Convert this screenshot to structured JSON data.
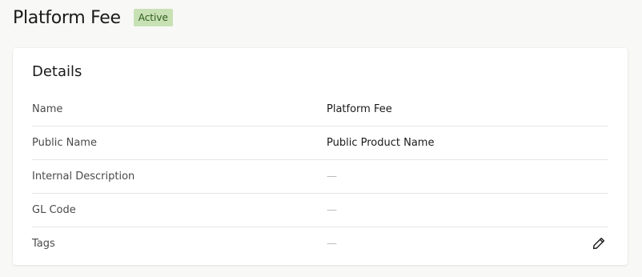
{
  "header": {
    "title": "Platform Fee",
    "status": "Active"
  },
  "details": {
    "title": "Details",
    "rows": [
      {
        "label": "Name",
        "value": "Platform Fee"
      },
      {
        "label": "Public Name",
        "value": "Public Product Name"
      },
      {
        "label": "Internal Description",
        "value": "—"
      },
      {
        "label": "GL Code",
        "value": "—"
      },
      {
        "label": "Tags",
        "value": "—"
      }
    ],
    "edit_icon": "pencil-icon"
  },
  "colors": {
    "background": "#f8f8f6",
    "badge_bg": "#c8e1b4",
    "badge_text": "#2e5a1c",
    "divider": "#e6e6e3",
    "empty_value": "#b8b8b8"
  }
}
